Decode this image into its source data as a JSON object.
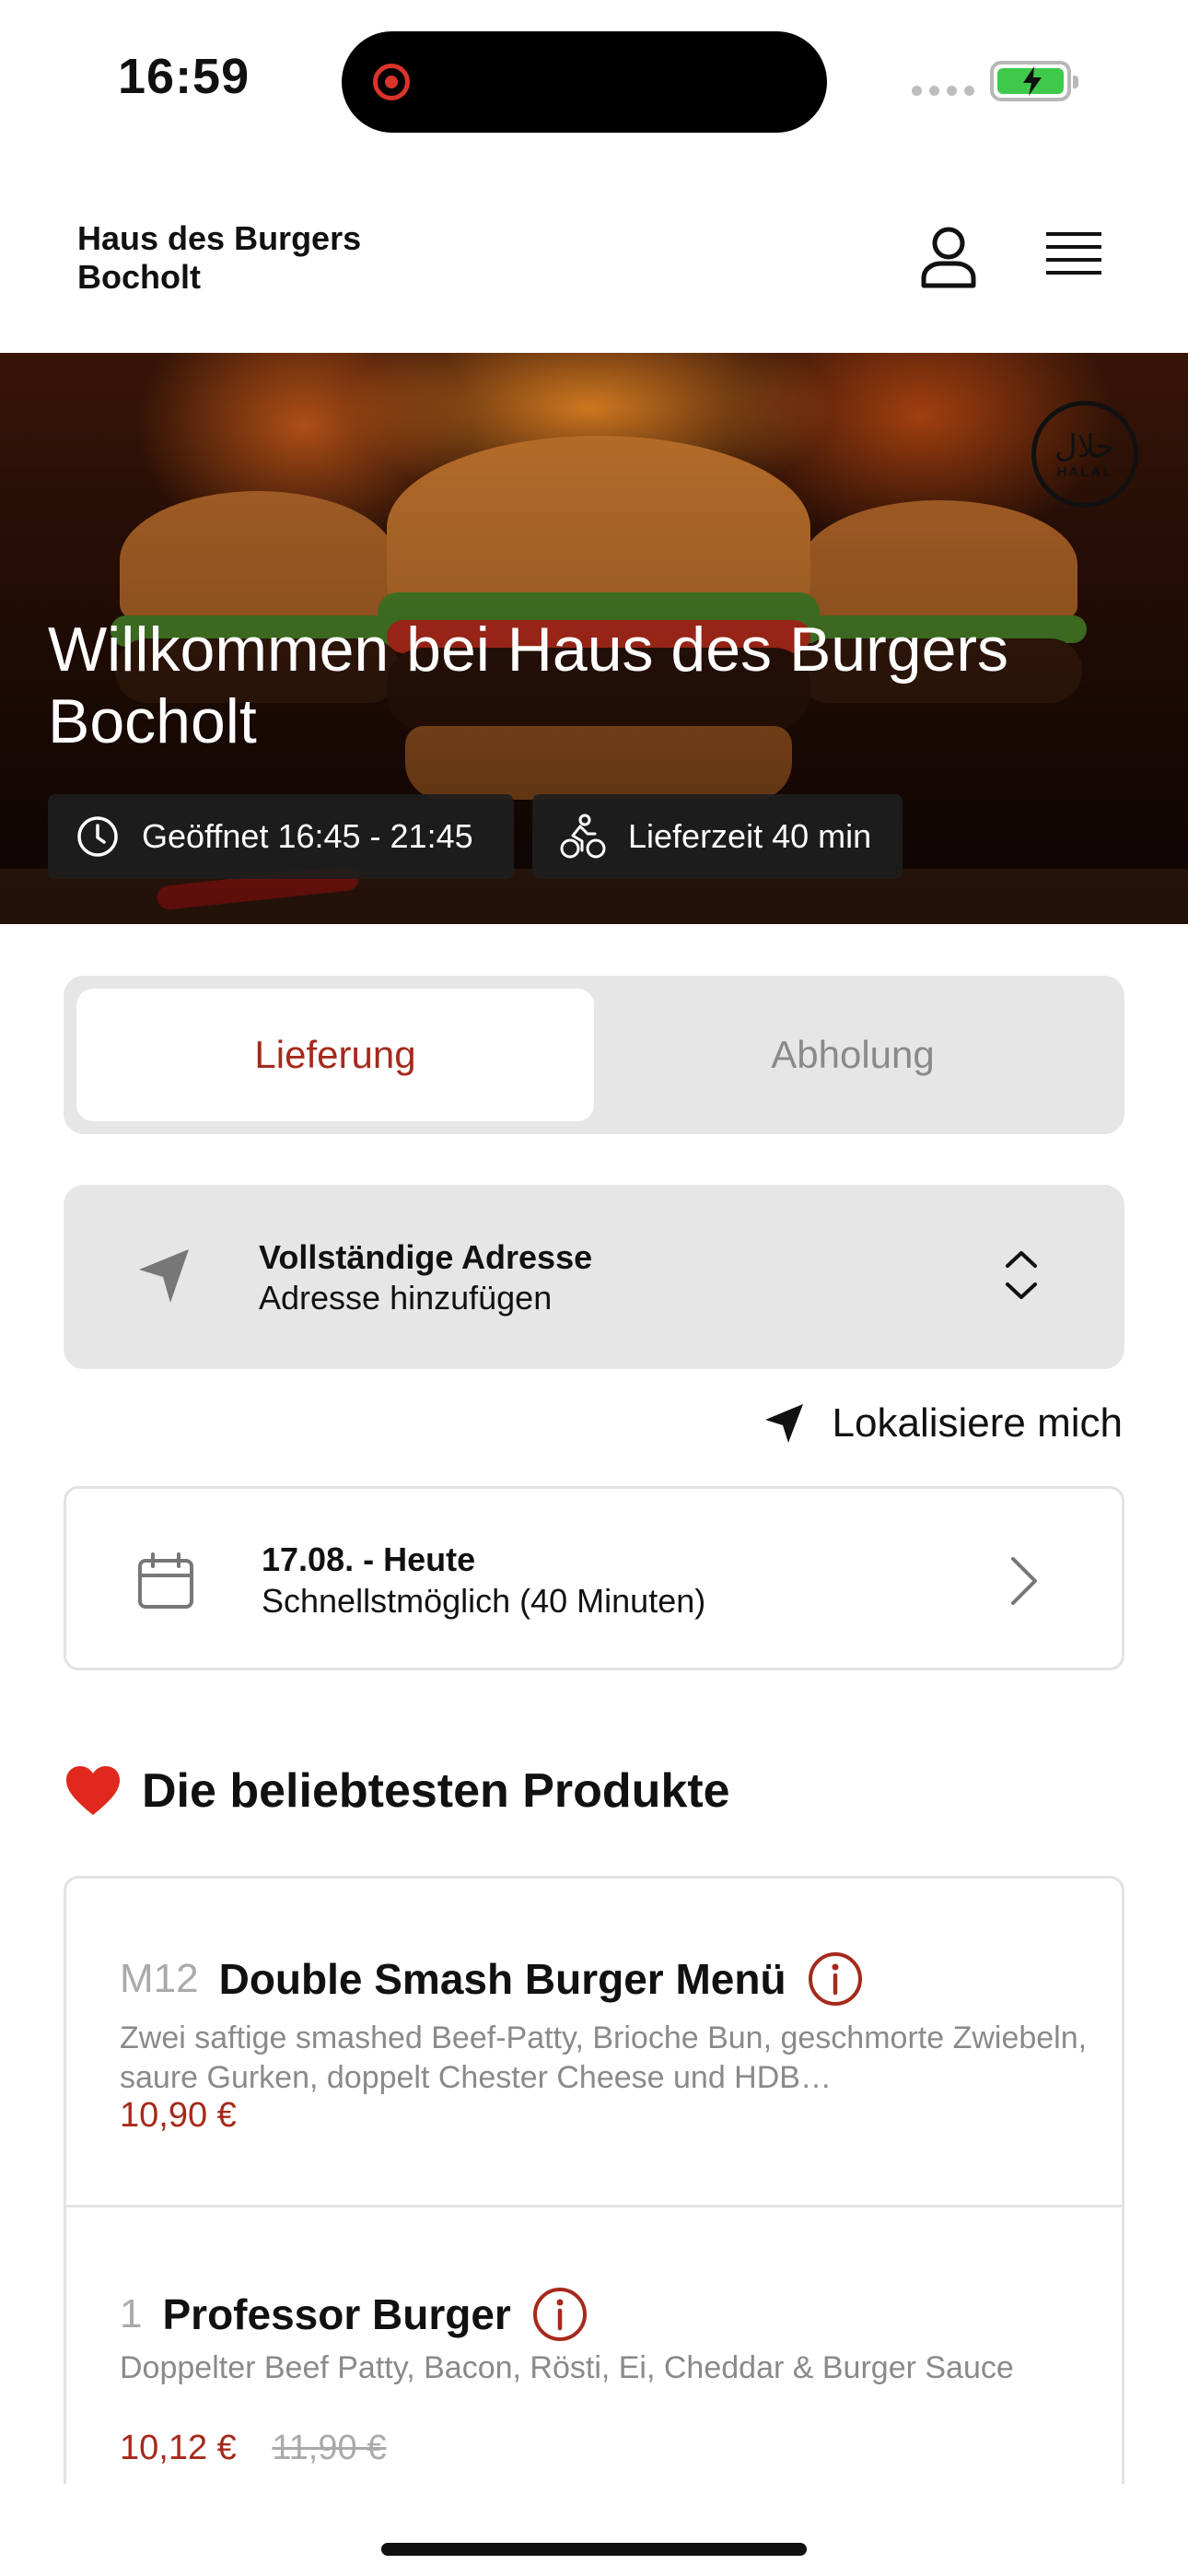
{
  "status_bar": {
    "time": "16:59"
  },
  "header": {
    "brand_line1": "Haus des Burgers",
    "brand_line2": "Bocholt"
  },
  "hero": {
    "title": "Willkommen bei Haus des Burgers Bocholt",
    "halal_arabic": "حلال",
    "halal_label": "HALAL",
    "open_chip": "Geöffnet 16:45 - 21:45",
    "delivery_chip": "Lieferzeit 40 min"
  },
  "tabs": {
    "delivery": "Lieferung",
    "pickup": "Abholung",
    "active": "delivery"
  },
  "address": {
    "title": "Vollständige Adresse",
    "subtitle": "Adresse hinzufügen"
  },
  "locate": {
    "label": "Lokalisiere mich"
  },
  "schedule": {
    "date": "17.08. - Heute",
    "time": "Schnellstmöglich (40 Minuten)"
  },
  "popular": {
    "heading": "Die beliebtesten Produkte",
    "products": [
      {
        "number": "M12",
        "name": "Double Smash Burger  Menü",
        "description": "Zwei saftige smashed Beef-Patty, Brioche Bun, geschmorte Zwiebeln, saure Gurken, doppelt Chester Cheese und HDB…",
        "price": "10,90 €"
      },
      {
        "number": "1",
        "name": "Professor Burger",
        "description": "Doppelter Beef Patty, Bacon, Rösti, Ei, Cheddar & Burger Sauce",
        "price": "10,12 €",
        "old_price": "11,90 €"
      }
    ]
  },
  "colors": {
    "accent": "#a52a1c",
    "card_gray": "#e6e6e6",
    "battery_green": "#3ec94a"
  }
}
